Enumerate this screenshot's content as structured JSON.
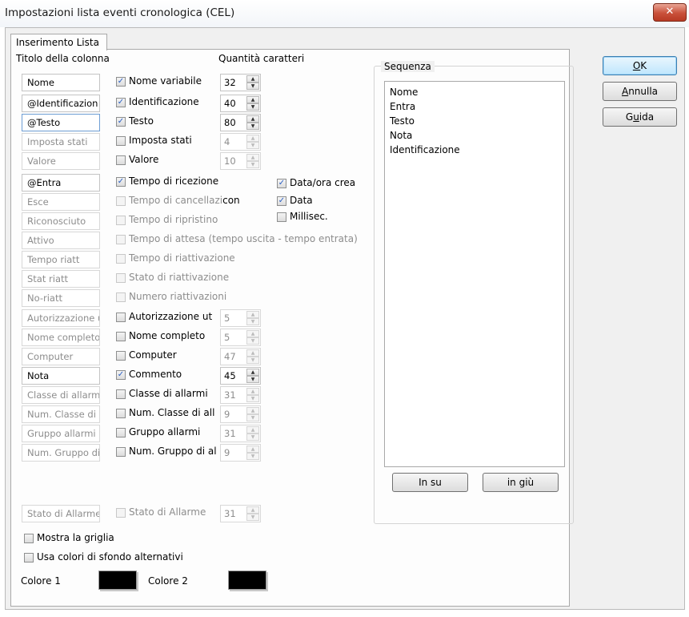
{
  "window": {
    "title": "Impostazioni lista eventi cronologica (CEL)",
    "close_glyph": "✕"
  },
  "tab": {
    "label": "Inserimento Lista"
  },
  "headers": {
    "column_title": "Titolo della colonna",
    "char_count": "Quantità caratteri"
  },
  "rows": [
    {
      "title": "Nome",
      "title_enabled": true,
      "check_label": "Nome variabile",
      "checked": true,
      "check_enabled": true,
      "spin": "32",
      "spin_enabled": true
    },
    {
      "title": "@Identificazion",
      "title_enabled": true,
      "check_label": "Identificazione",
      "checked": true,
      "check_enabled": true,
      "spin": "40",
      "spin_enabled": true
    },
    {
      "title": "@Testo",
      "title_enabled": true,
      "focused": true,
      "check_label": "Testo",
      "checked": true,
      "check_enabled": true,
      "spin": "80",
      "spin_enabled": true
    },
    {
      "title": "Imposta stati",
      "title_enabled": false,
      "check_label": "Imposta stati",
      "checked": false,
      "check_enabled": true,
      "spin": "4",
      "spin_enabled": false
    },
    {
      "title": "Valore",
      "title_enabled": false,
      "check_label": "Valore",
      "checked": false,
      "check_enabled": true,
      "spin": "10",
      "spin_enabled": false
    },
    {
      "title": "@Entra",
      "title_enabled": true,
      "check_label": "Tempo di ricezione",
      "checked": true,
      "check_enabled": true
    },
    {
      "title": "Esce",
      "title_enabled": false,
      "check_label": "Tempo di cancellazi",
      "check_suffix": "con",
      "checked": false,
      "check_enabled": false
    },
    {
      "title": "Riconosciuto",
      "title_enabled": false,
      "check_label": "Tempo di ripristino",
      "checked": false,
      "check_enabled": false
    },
    {
      "title": "Attivo",
      "title_enabled": false,
      "check_label": "Tempo di attesa (tempo uscita - tempo entrata)",
      "checked": false,
      "check_enabled": false
    },
    {
      "title": "Tempo riatt",
      "title_enabled": false,
      "check_label": "Tempo di riattivazione",
      "checked": false,
      "check_enabled": false
    },
    {
      "title": "Stat riatt",
      "title_enabled": false,
      "check_label": "Stato di riattivazione",
      "checked": false,
      "check_enabled": false
    },
    {
      "title": "No-riatt",
      "title_enabled": false,
      "check_label": "Numero riattivazioni",
      "checked": false,
      "check_enabled": false
    },
    {
      "title": "Autorizzazione u",
      "title_enabled": false,
      "check_label": "Autorizzazione ut",
      "checked": false,
      "check_enabled": true,
      "spin": "5",
      "spin_enabled": false
    },
    {
      "title": "Nome completo",
      "title_enabled": false,
      "check_label": "Nome completo",
      "checked": false,
      "check_enabled": true,
      "spin": "5",
      "spin_enabled": false
    },
    {
      "title": "Computer",
      "title_enabled": false,
      "check_label": "Computer",
      "checked": false,
      "check_enabled": true,
      "spin": "47",
      "spin_enabled": false
    },
    {
      "title": "Nota",
      "title_enabled": true,
      "check_label": "Commento",
      "checked": true,
      "check_enabled": true,
      "spin": "45",
      "spin_enabled": true
    },
    {
      "title": "Classe di allarmi",
      "title_enabled": false,
      "check_label": "Classe di allarmi",
      "checked": false,
      "check_enabled": true,
      "spin": "31",
      "spin_enabled": false
    },
    {
      "title": "Num. Classe di a",
      "title_enabled": false,
      "check_label": "Num. Classe di all",
      "checked": false,
      "check_enabled": true,
      "spin": "9",
      "spin_enabled": false
    },
    {
      "title": "Gruppo allarmi",
      "title_enabled": false,
      "check_label": "Gruppo allarmi",
      "checked": false,
      "check_enabled": true,
      "spin": "31",
      "spin_enabled": false
    },
    {
      "title": "Num. Gruppo di",
      "title_enabled": false,
      "check_label": "Num. Gruppo di al",
      "checked": false,
      "check_enabled": true,
      "spin": "9",
      "spin_enabled": false
    }
  ],
  "extra_row": {
    "title": "Stato di Allarme",
    "check_label": "Stato di Allarme",
    "spin": "31"
  },
  "date_options": [
    {
      "label": "Data/ora crea",
      "checked": true
    },
    {
      "label": "Data",
      "checked": true
    },
    {
      "label": "Millisec.",
      "checked": false
    }
  ],
  "grid": {
    "show_grid": "Mostra la griglia",
    "alt_colors": "Usa colori di sfondo alternativi",
    "color1": "Colore 1",
    "color2": "Colore 2"
  },
  "sequence": {
    "label": "Sequenza",
    "items": [
      "Nome",
      "Entra",
      "Testo",
      "Nota",
      "Identificazione"
    ],
    "up": "In su",
    "down": "in giù"
  },
  "buttons": {
    "ok_key": "O",
    "ok_rest": "K",
    "cancel_key": "A",
    "cancel_rest": "nnulla",
    "help_a": "G",
    "help_key": "u",
    "help_b": "ida"
  },
  "colors": {
    "checkmark": "#2a5fc4",
    "default_button": "#3c7fb1",
    "swatch": "#000000"
  }
}
